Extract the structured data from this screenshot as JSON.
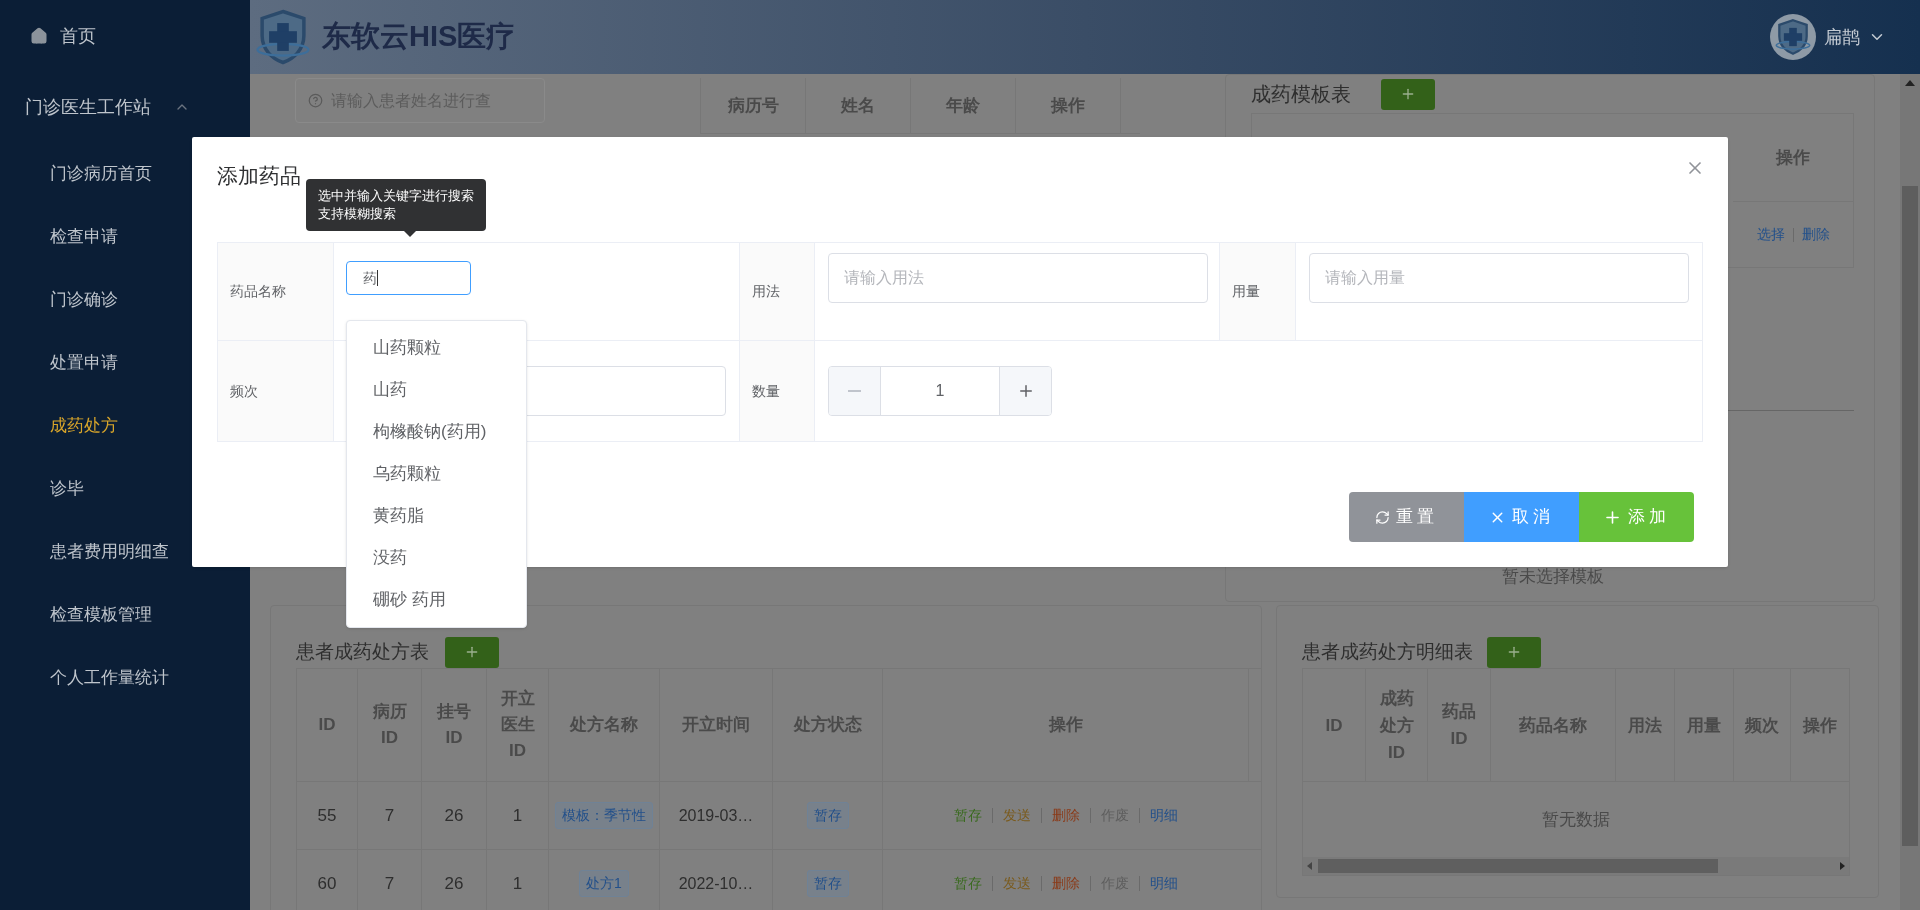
{
  "sidebar": {
    "items": [
      {
        "label": "首页",
        "kind": "link"
      },
      {
        "label": "门诊医生工作站",
        "kind": "group",
        "expanded": true,
        "children": [
          {
            "label": "门诊病历首页",
            "selected": false
          },
          {
            "label": "检查申请",
            "selected": false
          },
          {
            "label": "门诊确诊",
            "selected": false
          },
          {
            "label": "处置申请",
            "selected": false
          },
          {
            "label": "成药处方",
            "selected": true
          },
          {
            "label": "诊毕",
            "selected": false
          },
          {
            "label": "患者费用明细查",
            "selected": false
          },
          {
            "label": "检查模板管理",
            "selected": false
          },
          {
            "label": "个人工作量统计",
            "selected": false
          }
        ]
      }
    ]
  },
  "header": {
    "title": "东软云HIS医疗",
    "user": "扁鹊"
  },
  "patient_panel": {
    "search": {
      "placeholder": "请输入患者姓名进行查"
    },
    "columns": [
      "病历号",
      "姓名",
      "年龄",
      "操作"
    ]
  },
  "template_panel": {
    "title": "成药模板表",
    "columns": [
      "操作"
    ],
    "row_actions": [
      "选择",
      "删除"
    ],
    "empty_text": "暂未选择模板"
  },
  "prescription_panel": {
    "title": "患者成药处方表",
    "columns": [
      "ID",
      "病历ID",
      "挂号ID",
      "开立医生ID",
      "处方名称",
      "开立时间",
      "处方状态",
      "操作"
    ],
    "rows": [
      {
        "cells": [
          "55",
          "7",
          "26",
          "1"
        ],
        "name": "模板：季节性",
        "time": "2019-03…",
        "status": "暂存",
        "actions": [
          {
            "label": "暂存",
            "color": "#3a6a1f"
          },
          {
            "label": "发送",
            "color": "#7a5a1c"
          },
          {
            "label": "删除",
            "color": "#8a3a18"
          },
          {
            "label": "作废",
            "color": "#5e5e5e"
          },
          {
            "label": "明细",
            "color": "#23508a"
          }
        ]
      },
      {
        "cells": [
          "60",
          "7",
          "26",
          "1"
        ],
        "name": "处方1",
        "time": "2022-10…",
        "status": "暂存",
        "actions": [
          {
            "label": "暂存",
            "color": "#3a6a1f"
          },
          {
            "label": "发送",
            "color": "#7a5a1c"
          },
          {
            "label": "删除",
            "color": "#8a3a18"
          },
          {
            "label": "作废",
            "color": "#5e5e5e"
          },
          {
            "label": "明细",
            "color": "#23508a"
          }
        ]
      }
    ]
  },
  "detail_panel": {
    "title": "患者成药处方明细表",
    "columns": [
      "ID",
      "成药处方ID",
      "药品ID",
      "药品名称",
      "用法",
      "用量",
      "频次",
      "操作"
    ],
    "empty_text": "暂无数据"
  },
  "dialog": {
    "title": "添加药品",
    "tooltip": [
      "选中并输入关键字进行搜索",
      "支持模糊搜索"
    ],
    "fields": [
      {
        "label": "药品名称",
        "kind": "search",
        "value": "药"
      },
      {
        "label": "用法",
        "kind": "text",
        "placeholder": "请输入用法"
      },
      {
        "label": "用量",
        "kind": "text",
        "placeholder": "请输入用量"
      },
      {
        "label": "频次",
        "kind": "text"
      },
      {
        "label": "数量",
        "kind": "number",
        "value": "1"
      }
    ],
    "suggestions": [
      "山药颗粒",
      "山药",
      "枸橼酸钠(药用)",
      "乌药颗粒",
      "黄药脂",
      "没药",
      "硼砂 药用"
    ],
    "buttons": [
      {
        "label": "重置",
        "kind": "reset"
      },
      {
        "label": "取消",
        "kind": "cancel"
      },
      {
        "label": "添加",
        "kind": "add"
      }
    ]
  }
}
